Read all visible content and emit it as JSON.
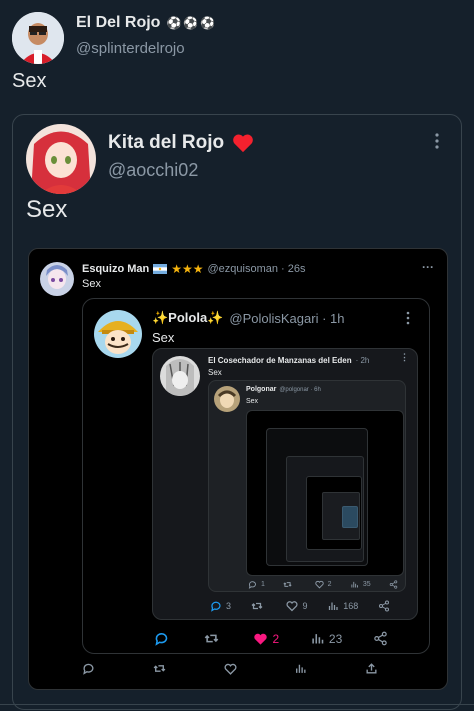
{
  "outer": {
    "name": "El Del Rojo",
    "name_emoji": "⚽⚽⚽",
    "handle": "@splinterdelrojo",
    "text": "Sex"
  },
  "quote1": {
    "name": "Kita del Rojo",
    "handle": "@aocchi02",
    "text": "Sex"
  },
  "quote2": {
    "name": "Esquizo Man",
    "stars": "★★★",
    "handle": "@ezquisoman · 26s",
    "text": "Sex",
    "replies": "",
    "retweets": "",
    "likes": "",
    "views": ""
  },
  "quote3": {
    "name": "✨Pololа✨",
    "handle": "@PololisKagari · 1h",
    "text": "Sex",
    "replies": "",
    "retweets": "",
    "likes": "2",
    "views": "23"
  },
  "quote4": {
    "name": "El Cosechador de Manzanas del Eden",
    "time": "· 2h",
    "text": "Sex",
    "replies": "3",
    "retweets": "",
    "likes": "9",
    "views": "168"
  },
  "quote5": {
    "name": "Polgonar",
    "handle": "@polgonar · 6h",
    "text": "Sex",
    "replies": "1",
    "retweets": "",
    "likes": "2",
    "views": "35"
  },
  "colors": {
    "bg": "#15202b",
    "card_dark": "#000000",
    "card_mid": "#16181c",
    "accent_like": "#f91880",
    "heart": "#f4212e",
    "muted": "#8b98a5"
  }
}
